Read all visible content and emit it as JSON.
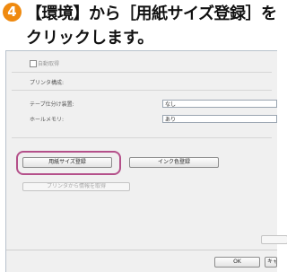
{
  "instruction": {
    "step_number": "4",
    "line1": "【環境】から［用紙サイズ登録］を",
    "line2": "クリックします。"
  },
  "dialog": {
    "auto_checkbox_label": "自動取得",
    "printer_section_label": "プリンタ構成:",
    "tape_cutter_label": "テープ仕分け装置:",
    "tape_cutter_value": "なし",
    "hole_memory_label": "ホールメモリ:",
    "hole_memory_value": "あり",
    "paper_size_button": "用紙サイズ登録",
    "ink_color_button": "インク色登録",
    "printer_info_button": "プリンタから情報を取得",
    "ok_button": "OK",
    "cancel_button": "キャンセル"
  }
}
